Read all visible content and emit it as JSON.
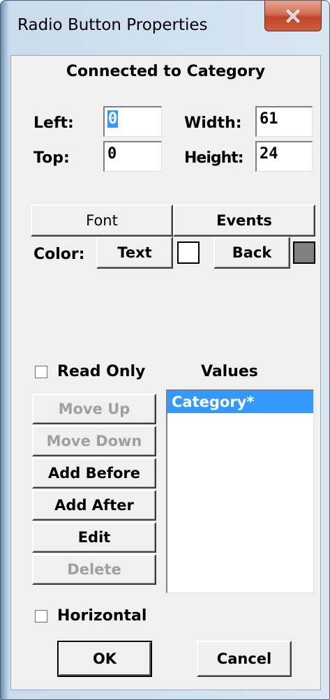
{
  "window": {
    "title": "Radio Button Properties",
    "close_glyph": "X"
  },
  "dialog": {
    "heading": "Connected to Category",
    "left_label": "Left:",
    "left_value": "0",
    "top_label": "Top:",
    "top_value": "0",
    "width_label": "Width:",
    "width_value": "61",
    "height_label": "Height:",
    "height_value": "24",
    "font_button": "Font",
    "events_button": "Events",
    "color_label": "Color:",
    "text_button": "Text",
    "back_button": "Back",
    "text_color": "#ffffff",
    "back_color": "#808080",
    "read_only_label": "Read Only",
    "read_only_checked": false,
    "values_label": "Values",
    "values": [
      {
        "label": "Category*",
        "selected": true
      }
    ],
    "move_up_button": "Move Up",
    "move_down_button": "Move Down",
    "add_before_button": "Add Before",
    "add_after_button": "Add After",
    "edit_button": "Edit",
    "delete_button": "Delete",
    "horizontal_label": "Horizontal",
    "horizontal_checked": false,
    "ok_button": "OK",
    "cancel_button": "Cancel"
  }
}
